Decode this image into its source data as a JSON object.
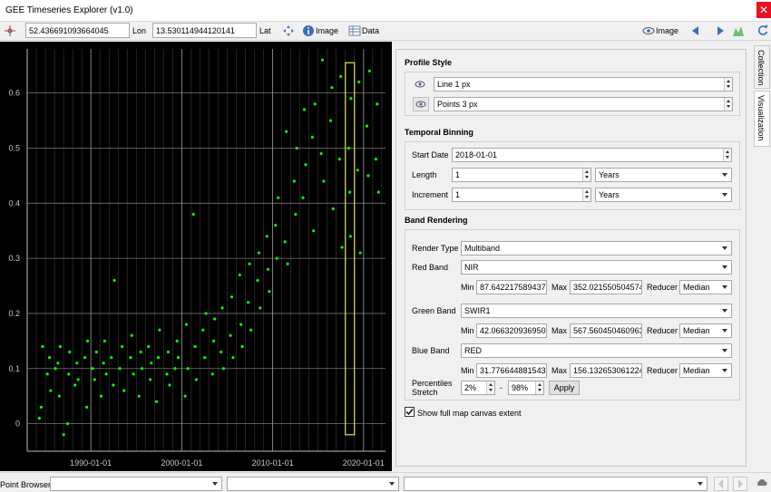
{
  "window": {
    "title": "GEE Timeseries Explorer (v1.0)",
    "close_glyph": "✕"
  },
  "toolbar": {
    "lat_value": "52.436691093664045",
    "lon_label": "Lon",
    "lon_value": "13.530114944120141",
    "lat_label": "Lat",
    "image_label": "Image",
    "data_label": "Data",
    "image_right_label": "Image"
  },
  "tabs": {
    "collection": "Collection",
    "visualization": "Visualization"
  },
  "panel": {
    "profile_style": {
      "title": "Profile Style",
      "line": "Line 1 px",
      "points": "Points 3 px"
    },
    "temporal_binning": {
      "title": "Temporal Binning",
      "start_date_label": "Start Date",
      "start_date": "2018-01-01",
      "length_label": "Length",
      "length": "1",
      "length_unit": "Years",
      "increment_label": "Increment",
      "increment": "1",
      "increment_unit": "Years"
    },
    "band_rendering": {
      "title": "Band Rendering",
      "render_type_label": "Render Type",
      "render_type": "Multiband",
      "min_label": "Min",
      "max_label": "Max",
      "reducer_label": "Reducer",
      "red": {
        "label": "Red Band",
        "band": "NIR",
        "min": "87.6422175894375",
        "max": "352.0215505045744",
        "reducer": "Median"
      },
      "green": {
        "label": "Green Band",
        "band": "SWIR1",
        "min": "42.06632093695089",
        "max": "567.5604504609637",
        "reducer": "Median"
      },
      "blue": {
        "label": "Blue Band",
        "band": "RED",
        "min": "31.77664488154318",
        "max": "156.1326530612246",
        "reducer": "Median"
      },
      "percentiles_label_1": "Percentiles",
      "percentiles_label_2": "Stretch",
      "p_low": "2%",
      "p_dash": "-",
      "p_high": "98%",
      "apply": "Apply"
    },
    "show_full_extent": {
      "label": "Show full map canvas extent",
      "checked": true
    }
  },
  "statusbar": {
    "point_browser_label": "Point Browser"
  },
  "chart_data": {
    "type": "scatter",
    "x_axis_type": "date",
    "xlim": [
      "1983-01-01",
      "2022-06-01"
    ],
    "ylim": [
      -0.05,
      0.68
    ],
    "xticks": [
      "1990-01-01",
      "2000-01-01",
      "2010-01-01",
      "2020-01-01"
    ],
    "ytick_values": [
      0,
      0.1,
      0.2,
      0.3,
      0.4,
      0.5,
      0.6
    ],
    "ytick_labels": [
      "0",
      "0.1",
      "0.2",
      "0.3",
      "0.4",
      "0.5",
      "0.6"
    ],
    "grid": true,
    "point_color": "#00ff00",
    "background": "#000000",
    "highlight_range": [
      "2018-01-01",
      "2019-01-01"
    ],
    "highlight_color": "#e6e65a",
    "series": [
      {
        "points": [
          [
            "1984-05-01",
            0.01
          ],
          [
            "1984-07-15",
            0.03
          ],
          [
            "1984-09-10",
            0.14
          ],
          [
            "1985-03-20",
            0.09
          ],
          [
            "1985-06-15",
            0.12
          ],
          [
            "1985-08-01",
            0.06
          ],
          [
            "1986-02-10",
            0.1
          ],
          [
            "1986-05-20",
            0.11
          ],
          [
            "1986-07-10",
            0.05
          ],
          [
            "1986-08-20",
            0.14
          ],
          [
            "1987-01-05",
            -0.02
          ],
          [
            "1987-06-12",
            0.0
          ],
          [
            "1987-07-25",
            0.09
          ],
          [
            "1987-09-01",
            0.13
          ],
          [
            "1988-04-02",
            0.07
          ],
          [
            "1988-06-18",
            0.11
          ],
          [
            "1988-08-08",
            0.08
          ],
          [
            "1989-05-05",
            0.12
          ],
          [
            "1989-07-19",
            0.03
          ],
          [
            "1989-08-22",
            0.15
          ],
          [
            "1990-03-11",
            0.1
          ],
          [
            "1990-06-04",
            0.08
          ],
          [
            "1990-08-15",
            0.13
          ],
          [
            "1991-02-17",
            0.05
          ],
          [
            "1991-05-27",
            0.11
          ],
          [
            "1991-07-08",
            0.15
          ],
          [
            "1991-09-12",
            0.09
          ],
          [
            "1992-04-05",
            0.12
          ],
          [
            "1992-06-21",
            0.07
          ],
          [
            "1992-08-03",
            0.26
          ],
          [
            "1993-03-14",
            0.1
          ],
          [
            "1993-06-09",
            0.14
          ],
          [
            "1993-08-25",
            0.06
          ],
          [
            "1994-05-18",
            0.12
          ],
          [
            "1994-07-02",
            0.16
          ],
          [
            "1994-09-09",
            0.09
          ],
          [
            "1995-04-21",
            0.05
          ],
          [
            "1995-06-30",
            0.13
          ],
          [
            "1995-08-14",
            0.1
          ],
          [
            "1996-05-07",
            0.14
          ],
          [
            "1996-07-16",
            0.08
          ],
          [
            "1996-08-28",
            0.11
          ],
          [
            "1997-03-19",
            0.04
          ],
          [
            "1997-06-02",
            0.12
          ],
          [
            "1997-07-24",
            0.17
          ],
          [
            "1998-05-13",
            0.09
          ],
          [
            "1998-07-06",
            0.13
          ],
          [
            "1998-09-01",
            0.07
          ],
          [
            "1999-04-08",
            0.1
          ],
          [
            "1999-06-26",
            0.15
          ],
          [
            "1999-08-11",
            0.12
          ],
          [
            "2000-05-16",
            0.05
          ],
          [
            "2000-07-04",
            0.18
          ],
          [
            "2000-09-02",
            0.1
          ],
          [
            "2001-04-12",
            0.38
          ],
          [
            "2001-06-22",
            0.14
          ],
          [
            "2001-08-09",
            0.08
          ],
          [
            "2002-05-03",
            0.17
          ],
          [
            "2002-07-14",
            0.12
          ],
          [
            "2002-08-30",
            0.2
          ],
          [
            "2003-05-21",
            0.09
          ],
          [
            "2003-07-09",
            0.15
          ],
          [
            "2003-08-17",
            0.19
          ],
          [
            "2004-04-27",
            0.13
          ],
          [
            "2004-06-15",
            0.21
          ],
          [
            "2004-08-06",
            0.1
          ],
          [
            "2005-05-11",
            0.16
          ],
          [
            "2005-07-02",
            0.23
          ],
          [
            "2005-08-24",
            0.12
          ],
          [
            "2006-05-19",
            0.27
          ],
          [
            "2006-07-08",
            0.18
          ],
          [
            "2006-08-29",
            0.14
          ],
          [
            "2007-04-23",
            0.22
          ],
          [
            "2007-06-17",
            0.29
          ],
          [
            "2007-08-10",
            0.17
          ],
          [
            "2008-05-06",
            0.26
          ],
          [
            "2008-07-01",
            0.31
          ],
          [
            "2008-08-20",
            0.21
          ],
          [
            "2009-05-14",
            0.34
          ],
          [
            "2009-06-30",
            0.28
          ],
          [
            "2009-08-18",
            0.24
          ],
          [
            "2010-04-26",
            0.36
          ],
          [
            "2010-06-20",
            0.3
          ],
          [
            "2010-08-12",
            0.41
          ],
          [
            "2011-05-09",
            0.33
          ],
          [
            "2011-07-04",
            0.53
          ],
          [
            "2011-08-25",
            0.29
          ],
          [
            "2012-05-17",
            0.44
          ],
          [
            "2012-07-10",
            0.38
          ],
          [
            "2012-08-28",
            0.5
          ],
          [
            "2013-05-02",
            0.41
          ],
          [
            "2013-06-25",
            0.57
          ],
          [
            "2013-08-19",
            0.47
          ],
          [
            "2014-05-13",
            0.52
          ],
          [
            "2014-07-05",
            0.35
          ],
          [
            "2014-08-29",
            0.58
          ],
          [
            "2015-05-06",
            0.49
          ],
          [
            "2015-06-24",
            0.66
          ],
          [
            "2015-08-17",
            0.44
          ],
          [
            "2016-05-18",
            0.55
          ],
          [
            "2016-07-08",
            0.61
          ],
          [
            "2016-08-26",
            0.39
          ],
          [
            "2017-05-10",
            0.48
          ],
          [
            "2017-06-29",
            0.63
          ],
          [
            "2017-08-21",
            0.32
          ],
          [
            "2018-05-15",
            0.5
          ],
          [
            "2018-06-27",
            0.42
          ],
          [
            "2018-07-20",
            0.34
          ],
          [
            "2018-08-12",
            0.59
          ],
          [
            "2019-05-09",
            0.46
          ],
          [
            "2019-06-30",
            0.62
          ],
          [
            "2019-08-22",
            0.31
          ],
          [
            "2020-05-14",
            0.54
          ],
          [
            "2020-07-06",
            0.45
          ],
          [
            "2020-08-27",
            0.64
          ],
          [
            "2021-05-11",
            0.48
          ],
          [
            "2021-07-02",
            0.58
          ],
          [
            "2021-08-24",
            0.42
          ]
        ]
      }
    ]
  }
}
